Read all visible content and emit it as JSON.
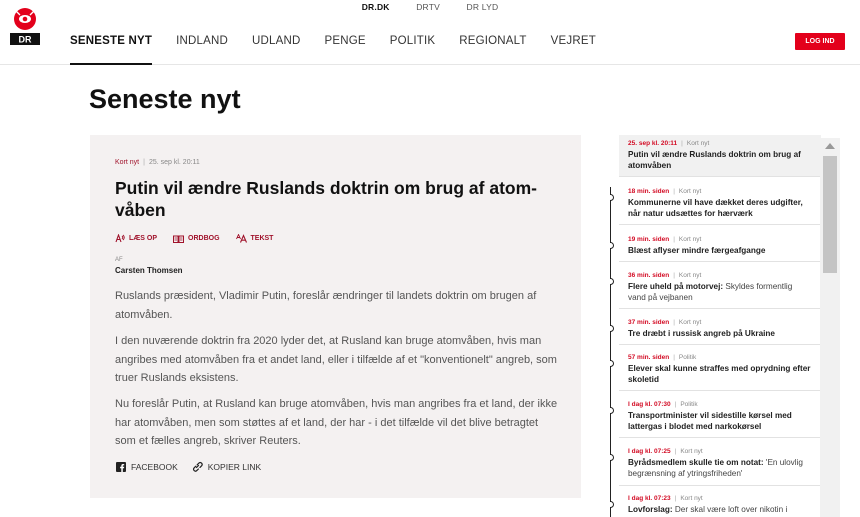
{
  "header": {
    "logo_text": "DR",
    "top_links": [
      "DR.DK",
      "DRTV",
      "DR LYD"
    ],
    "nav": [
      "SENESTE NYT",
      "INDLAND",
      "UDLAND",
      "PENGE",
      "POLITIK",
      "REGIONALT",
      "VEJRET"
    ],
    "login_label": "LOG IND"
  },
  "page": {
    "title": "Seneste nyt"
  },
  "article": {
    "category": "Kort nyt",
    "date": "25. sep kl. 20:11",
    "headline": "Putin vil ændre Ruslands doktrin om brug af atom-våben",
    "tools": [
      "LÆS OP",
      "ORDBOG",
      "TEKST"
    ],
    "byline_label": "AF",
    "author": "Carsten Thomsen",
    "paragraphs": [
      "Ruslands præsident, Vladimir Putin, foreslår ændringer til landets doktrin om brugen af atomvåben.",
      "I den nuværende doktrin fra 2020 lyder det, at Rusland kan bruge atomvåben, hvis man angribes med atomvåben fra et andet land, eller i tilfælde af et \"konventionelt\" angreb, som truer Ruslands eksistens.",
      "Nu foreslår Putin, at Rusland kan bruge atomvåben, hvis man angribes fra et land, der ikke har atomvåben, men som støttes af et land, der har - i det tilfælde vil det blive betragtet som et fælles angreb, skriver Reuters."
    ],
    "share": [
      "FACEBOOK",
      "KOPIER LINK"
    ]
  },
  "sidebar": {
    "entries": [
      {
        "time": "25. sep kl. 20:11",
        "category": "Kort nyt",
        "lead": "",
        "title": "Putin vil ændre Ruslands doktrin om brug af atomvåben"
      },
      {
        "time": "18 min. siden",
        "category": "Kort nyt",
        "lead": "",
        "title": "Kommunerne vil have dækket deres udgifter, når natur udsættes for hærværk"
      },
      {
        "time": "19 min. siden",
        "category": "Kort nyt",
        "lead": "",
        "title": "Blæst aflyser mindre færgeafgange"
      },
      {
        "time": "36 min. siden",
        "category": "Kort nyt",
        "lead": "Flere uheld på motorvej:",
        "title": "Skyldes formentlig vand på vejbanen"
      },
      {
        "time": "37 min. siden",
        "category": "Kort nyt",
        "lead": "",
        "title": "Tre dræbt i russisk angreb på Ukraine"
      },
      {
        "time": "57 min. siden",
        "category": "Politik",
        "lead": "",
        "title": "Elever skal kunne straffes med oprydning efter skoletid"
      },
      {
        "time": "I dag kl. 07:30",
        "category": "Politik",
        "lead": "",
        "title": "Transportminister vil sidestille kørsel med lattergas i blodet med narkokørsel"
      },
      {
        "time": "I dag kl. 07:25",
        "category": "Kort nyt",
        "lead": "Byrådsmedlem skulle tie om notat:",
        "title": "'En ulovlig begrænsning af ytringsfriheden'"
      },
      {
        "time": "I dag kl. 07:23",
        "category": "Kort nyt",
        "lead": "Lovforslag:",
        "title": "Der skal være loft over nikotin i"
      }
    ]
  },
  "colors": {
    "brand_red": "#e3001b",
    "accent": "#a0122b",
    "card_bg": "#f4f1f1"
  }
}
